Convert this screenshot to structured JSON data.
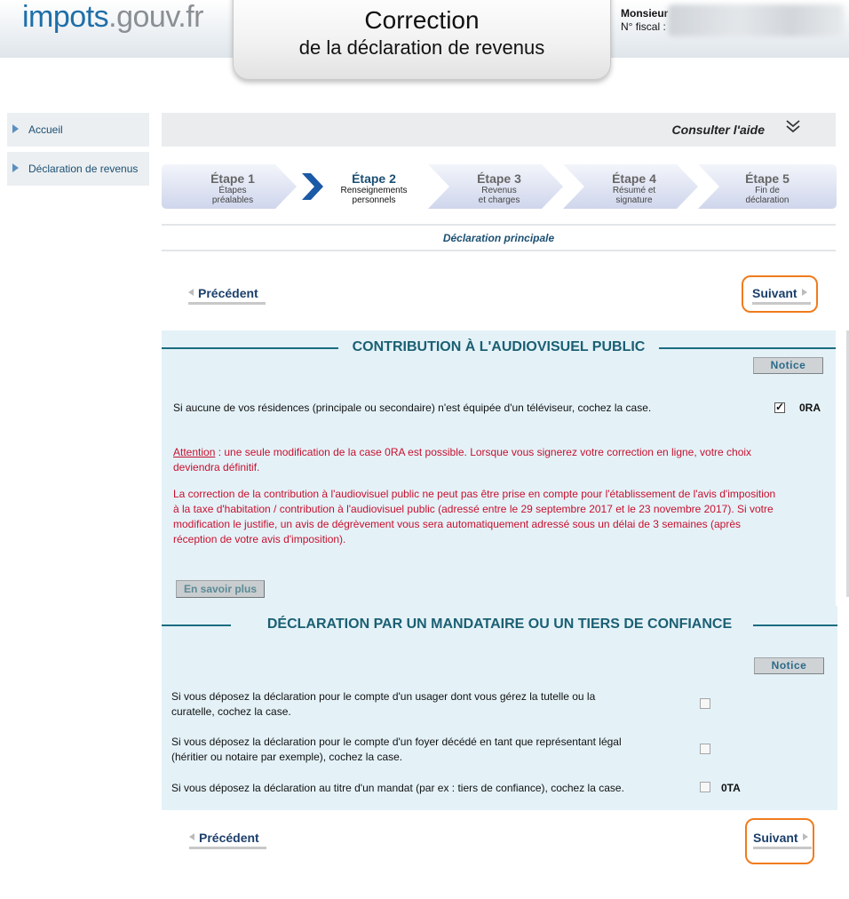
{
  "header": {
    "logo_part1": "impots",
    "logo_part2": ".gouv.fr",
    "title_line1": "Correction",
    "title_line2": "de la déclaration de revenus",
    "user_label": "Monsieur",
    "fiscal_label": "N° fiscal :"
  },
  "sidebar": {
    "items": [
      {
        "label": "Accueil"
      },
      {
        "label": "Déclaration de revenus"
      }
    ]
  },
  "help": {
    "label": "Consulter l'aide",
    "icon": "double-chevron-down-icon"
  },
  "steps": [
    {
      "num": "Étape 1",
      "line1": "Étapes",
      "line2": "préalables",
      "active": false
    },
    {
      "num": "Étape 2",
      "line1": "Renseignements",
      "line2": "personnels",
      "active": true
    },
    {
      "num": "Étape 3",
      "line1": "Revenus",
      "line2": "et charges",
      "active": false
    },
    {
      "num": "Étape 4",
      "line1": "Résumé et",
      "line2": "signature",
      "active": false
    },
    {
      "num": "Étape 5",
      "line1": "Fin de",
      "line2": "déclaration",
      "active": false
    }
  ],
  "subtitle": "Déclaration principale",
  "nav": {
    "prev_label": "Précédent",
    "next_label": "Suivant"
  },
  "audiovisuel": {
    "title": "CONTRIBUTION À L'AUDIOVISUEL PUBLIC",
    "notice_label": "Notice",
    "question": "Si aucune de vos résidences (principale ou secondaire) n'est équipée d'un téléviseur, cochez la case.",
    "code": "0RA",
    "checked": true,
    "warn1_prefix": "Attention",
    "warn1_line1": " : une seule modification de la case 0RA est possible. Lorsque vous signerez votre correction en ligne, votre choix",
    "warn1_line2": "deviendra définitif.",
    "warn2_lines": [
      "La correction de la contribution à l'audiovisuel public ne peut pas être prise en compte pour l'établissement de l'avis d'imposition",
      "à la taxe d'habitation / contribution à l'audiovisuel public (adressé entre le 29 septembre 2017 et le 23 novembre 2017). Si votre",
      "modification le justifie, un avis de dégrèvement vous sera automatiquement adressé sous un délai de 3 semaines (après",
      "réception de votre avis d'imposition)."
    ],
    "savoir_label": "En savoir plus"
  },
  "mandataire": {
    "title": "DÉCLARATION PAR UN MANDATAIRE OU UN TIERS DE CONFIANCE",
    "notice_label": "Notice",
    "q1_line1": "Si vous déposez la déclaration pour le compte d'un usager dont vous gérez la tutelle ou la",
    "q1_line2": "curatelle, cochez la case.",
    "q2_line1": "Si vous déposez la déclaration pour le compte d'un foyer décédé en tant que représentant légal",
    "q2_line2": "(héritier ou notaire par exemple), cochez la case.",
    "q3": "Si vous déposez la déclaration au titre d'un mandat (par ex : tiers de confiance), cochez la case.",
    "q3_code": "0TA"
  },
  "colors": {
    "accent": "#1b5f73",
    "orange": "#f07c1e",
    "warn": "#c8102e",
    "section_bg": "#e4f2f8"
  }
}
